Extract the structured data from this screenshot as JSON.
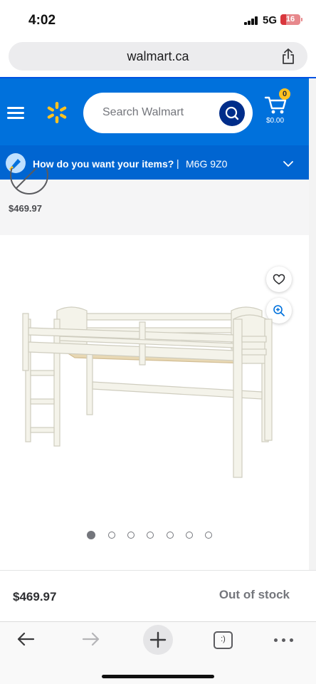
{
  "status_bar": {
    "time": "4:02",
    "network": "5G",
    "battery": "16"
  },
  "browser": {
    "url": "walmart.ca"
  },
  "header": {
    "search_placeholder": "Search Walmart",
    "cart_count": "0",
    "cart_total": "$0.00",
    "brand_color": "#0071dc",
    "accent_color": "#ffc220"
  },
  "delivery": {
    "question": "How do you want your items?",
    "separator": "|",
    "postal_code": "M6G 9Z0"
  },
  "previous_item": {
    "price": "$469.97"
  },
  "gallery": {
    "image_count": 7,
    "active_index": 0
  },
  "product": {
    "price": "$469.97",
    "availability": "Out of stock"
  },
  "toolbar": {
    "tabs_label": ":)"
  }
}
